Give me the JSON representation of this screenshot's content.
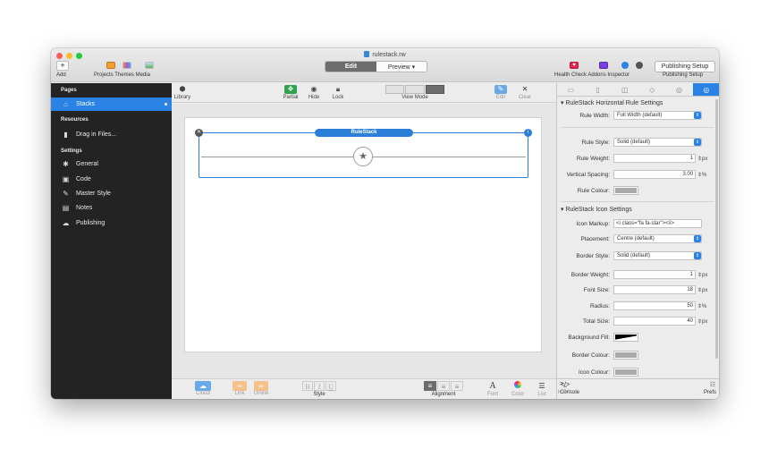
{
  "window": {
    "title": "rulestack.rw"
  },
  "colors": {
    "accent": "#2a82e4",
    "sidebar_bg": "#232323",
    "health": "#e2264d",
    "addons": "#7b3fe4"
  },
  "toolbar": {
    "add": "Add",
    "add_glyph": "+",
    "labels": "Projects Themes Media",
    "mode_edit": "Edit",
    "mode_preview": "Preview ▾",
    "right_labels": "Health Check  Addons    Inspector",
    "publishing_setup_button": "Publishing Setup",
    "publishing_setup_label": "Publishing Setup"
  },
  "sidebar": {
    "pages_heading": "Pages",
    "pages": [
      {
        "label": "Stacks",
        "icon": "home-icon"
      }
    ],
    "resources_heading": "Resources",
    "resources": [
      {
        "label": "Drag in Files...",
        "icon": "file-icon"
      }
    ],
    "settings_heading": "Settings",
    "settings": [
      {
        "label": "General",
        "icon": "gear-icon"
      },
      {
        "label": "Code",
        "icon": "code-icon"
      },
      {
        "label": "Master Style",
        "icon": "brush-icon"
      },
      {
        "label": "Notes",
        "icon": "notes-icon"
      },
      {
        "label": "Publishing",
        "icon": "cloud-icon"
      }
    ]
  },
  "edit_toolbar": {
    "library": "Library",
    "partial": "Partial",
    "hide": "Hide",
    "lock": "Lock",
    "view_mode": "View Mode",
    "edit": "Edit",
    "clear": "Clear"
  },
  "canvas": {
    "stack_label": "RuleStack"
  },
  "bottom_toolbar": {
    "cloud": "Cloud",
    "link": "Link",
    "unlink": "Unlink",
    "style": "Style",
    "alignment": "Alignment",
    "font": "Font",
    "color": "Color",
    "list": "List",
    "html": "HTML",
    "bold": "B",
    "italic": "I",
    "underline": "U",
    "font_glyph": "A",
    "html_glyph": "</>"
  },
  "inspector": {
    "section1_title": "RuleStack Horizontal Rule Settings",
    "rule_width_label": "Rule Width:",
    "rule_width_value": "Full Width (default)",
    "rule_style_label": "Rule Style:",
    "rule_style_value": "Solid (default)",
    "rule_weight_label": "Rule Weight:",
    "rule_weight_value": "1",
    "vertical_spacing_label": "Vertical Spacing:",
    "vertical_spacing_value": "3.00",
    "rule_colour_label": "Rule Colour:",
    "section2_title": "RuleStack Icon Settings",
    "icon_markup_label": "Icon Markup:",
    "icon_markup_value": "<i class=\"fa fa-star\"></i>",
    "placement_label": "Placement:",
    "placement_value": "Centre (default)",
    "border_style_label": "Border Style:",
    "border_style_value": "Solid (default)",
    "border_weight_label": "Border Weight:",
    "border_weight_value": "1",
    "font_size_label": "Font Size:",
    "font_size_value": "18",
    "radius_label": "Radius:",
    "radius_value": "50",
    "total_size_label": "Total Size:",
    "total_size_value": "40",
    "background_fill_label": "Background Fill:",
    "border_colour_label": "Border Colour:",
    "icon_colour_label": "Icon Colour:",
    "unit_px": "px",
    "unit_pct": "%",
    "console": "Console",
    "console_glyph": ">_",
    "prefs": "Prefs"
  }
}
